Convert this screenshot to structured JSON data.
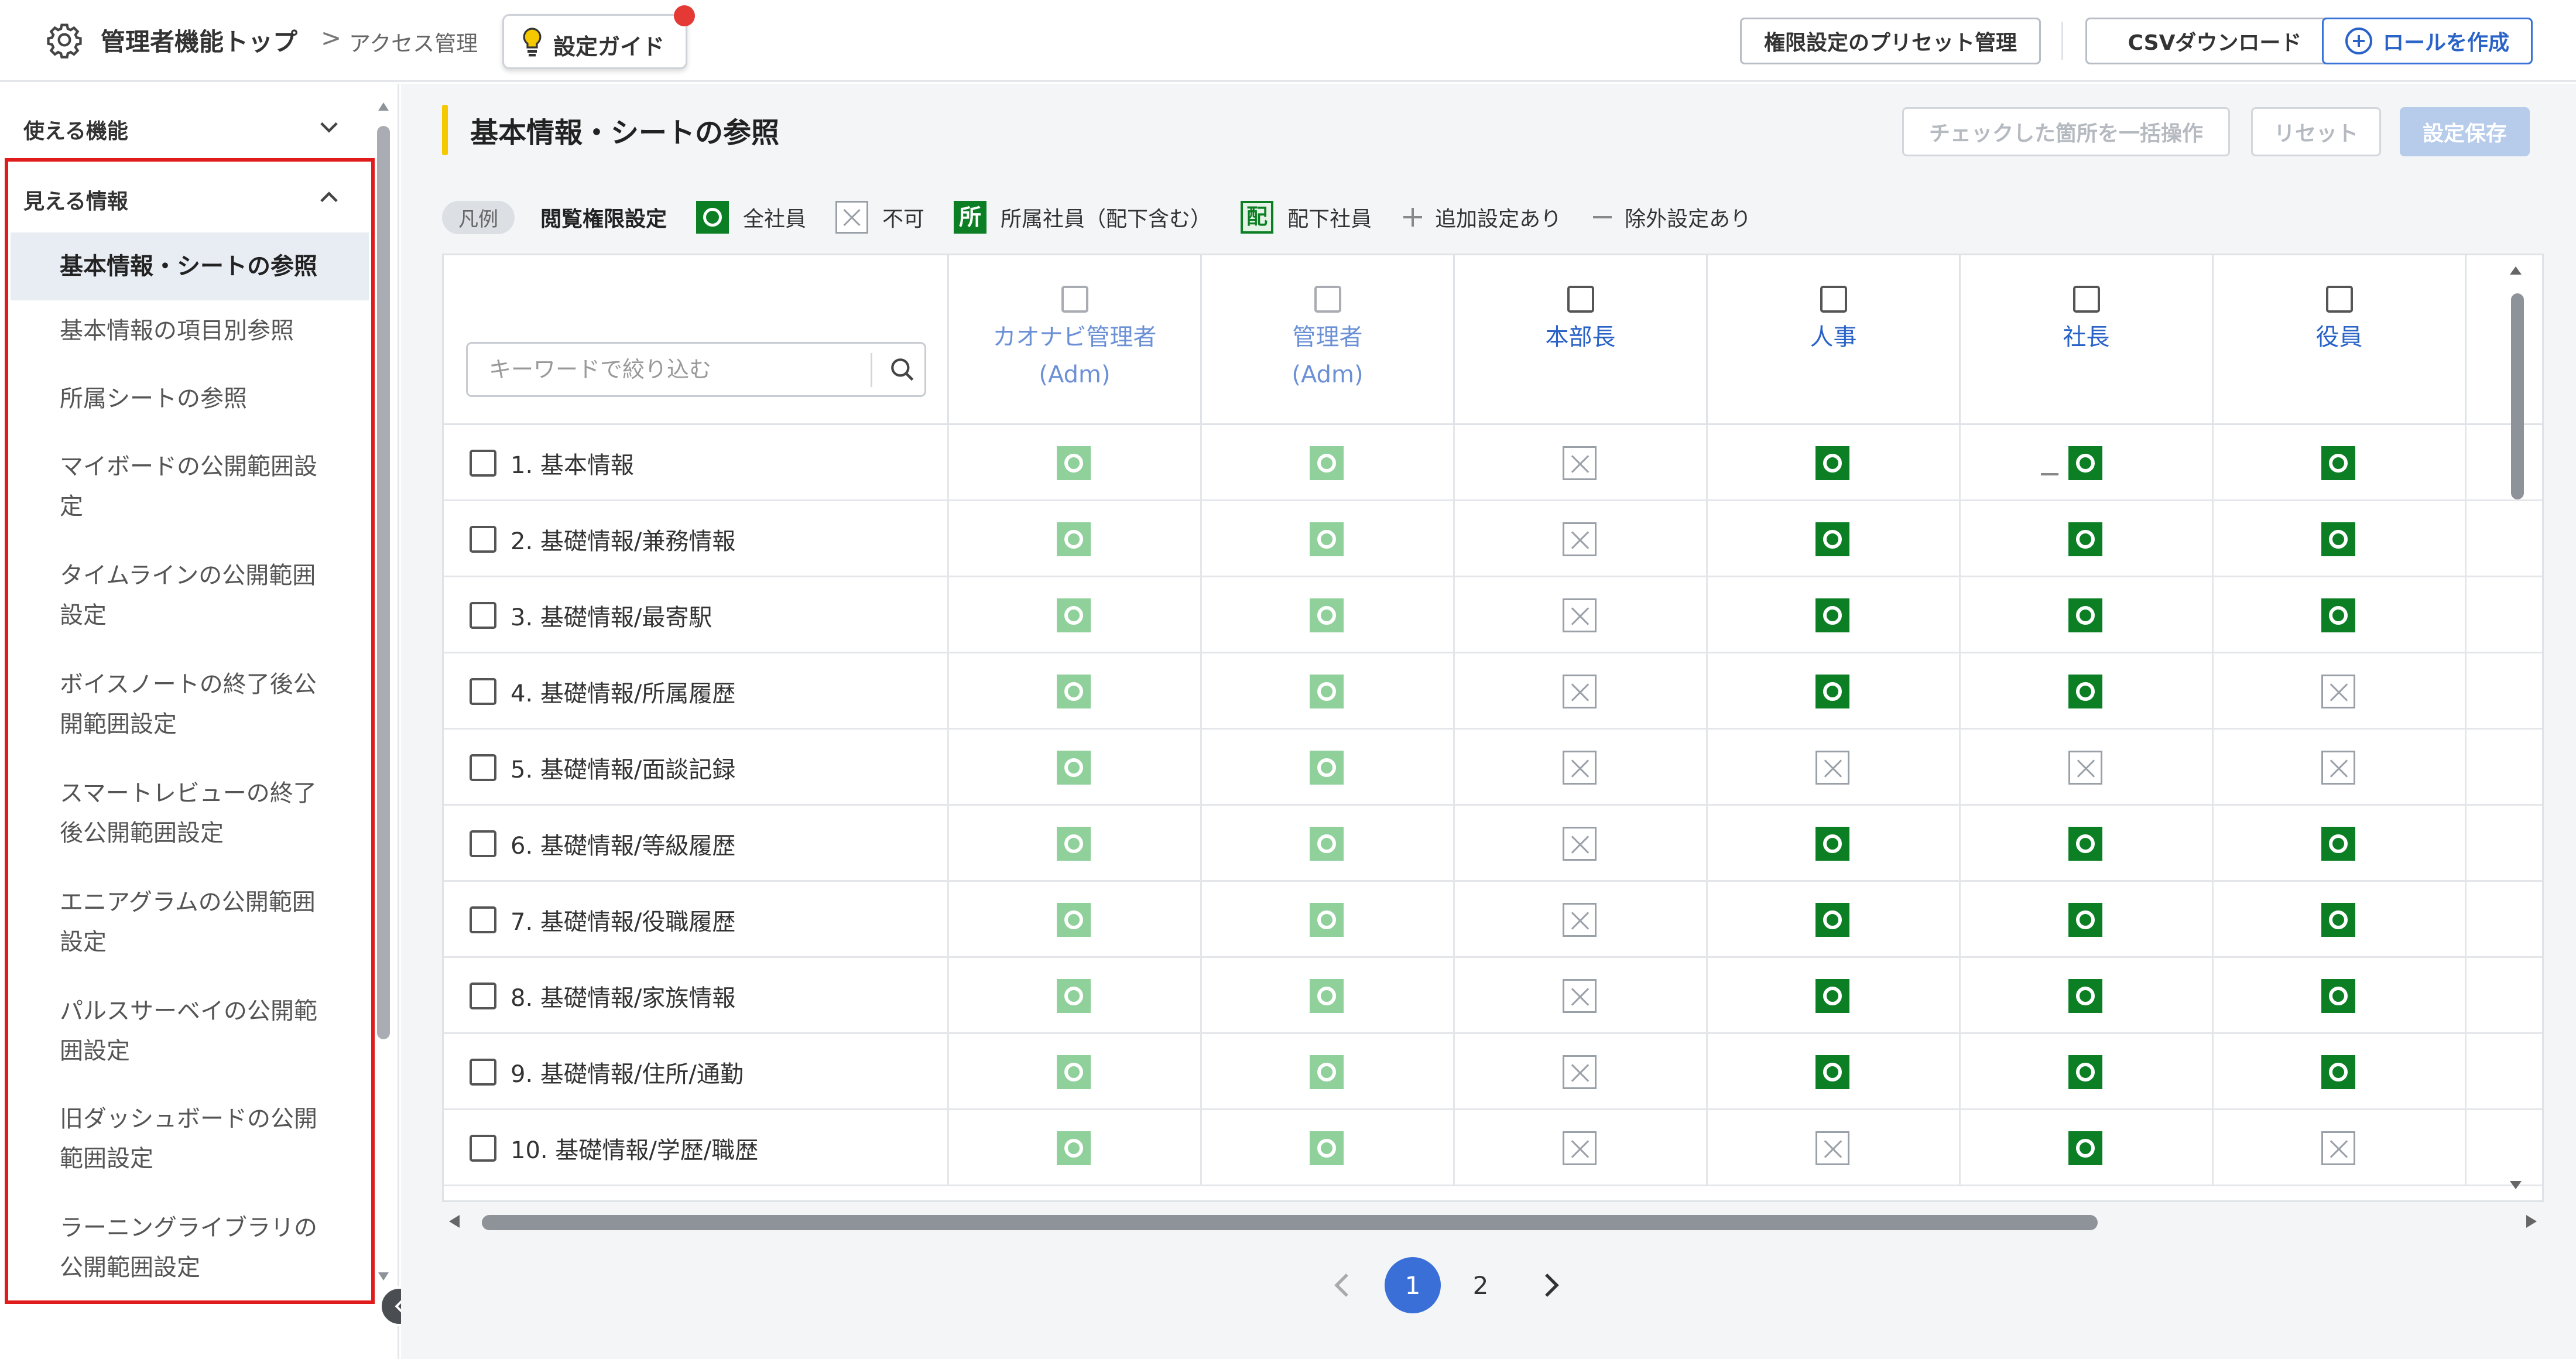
{
  "header": {
    "title": "管理者機能トップ",
    "breadcrumb_sep": ">",
    "breadcrumb": "アクセス管理",
    "guide_label": "設定ガイド",
    "preset_btn": "権限設定のプリセット管理",
    "csv_btn": "CSVダウンロード",
    "role_btn": "ロールを作成"
  },
  "sidebar": {
    "group1": "使える機能",
    "group2": "見える情報",
    "items": [
      "基本情報・シートの参照",
      "基本情報の項目別参照",
      "所属シートの参照",
      "マイボードの公開範囲設\n定",
      "タイムラインの公開範囲\n設定",
      "ボイスノートの終了後公\n開範囲設定",
      "スマートレビューの終了\n後公開範囲設定",
      "エニアグラムの公開範囲\n設定",
      "パルスサーベイの公開範\n囲設定",
      "旧ダッシュボードの公開\n範囲設定",
      "ラーニングライブラリの\n公開範囲設定"
    ]
  },
  "main": {
    "title": "基本情報・シートの参照",
    "bulk_btn": "チェックした箇所を一括操作",
    "reset_btn": "リセット",
    "save_btn": "設定保存",
    "legend": {
      "chip": "凡例",
      "title": "閲覧権限設定",
      "all": "全社員",
      "none": "不可",
      "affiliated_icon": "所",
      "affiliated": "所属社員（配下含む）",
      "subordinate_icon": "配",
      "subordinate": "配下社員",
      "add": "追加設定あり",
      "exclude": "除外設定あり"
    },
    "search_placeholder": "キーワードで絞り込む",
    "columns": [
      "カオナビ管理者\n(Adm)",
      "管理者\n(Adm)",
      "本部長",
      "人事",
      "社長",
      "役員"
    ],
    "rows": [
      {
        "label": "1. 基本情報",
        "marks": [
          "faded",
          "faded",
          "no",
          "all",
          "all",
          "all"
        ]
      },
      {
        "label": "2. 基礎情報/兼務情報",
        "marks": [
          "faded",
          "faded",
          "no",
          "all",
          "all",
          "all"
        ]
      },
      {
        "label": "3. 基礎情報/最寄駅",
        "marks": [
          "faded",
          "faded",
          "no",
          "all",
          "all",
          "all"
        ]
      },
      {
        "label": "4. 基礎情報/所属履歴",
        "marks": [
          "faded",
          "faded",
          "no",
          "all",
          "all",
          "no"
        ]
      },
      {
        "label": "5. 基礎情報/面談記録",
        "marks": [
          "faded",
          "faded",
          "no",
          "no",
          "no",
          "no"
        ]
      },
      {
        "label": "6. 基礎情報/等級履歴",
        "marks": [
          "faded",
          "faded",
          "no",
          "all",
          "all",
          "all"
        ]
      },
      {
        "label": "7. 基礎情報/役職履歴",
        "marks": [
          "faded",
          "faded",
          "no",
          "all",
          "all",
          "all"
        ]
      },
      {
        "label": "8. 基礎情報/家族情報",
        "marks": [
          "faded",
          "faded",
          "no",
          "all",
          "all",
          "all"
        ]
      },
      {
        "label": "9. 基礎情報/住所/通勤",
        "marks": [
          "faded",
          "faded",
          "no",
          "all",
          "all",
          "all"
        ]
      },
      {
        "label": "10. 基礎情報/学歴/職歴",
        "marks": [
          "faded",
          "faded",
          "no",
          "no",
          "all",
          "no"
        ]
      }
    ]
  },
  "pagination": {
    "pages": [
      "1",
      "2"
    ],
    "current": "1"
  },
  "colors": {
    "accent": "#3a6fd8",
    "green": "#0c7f24",
    "green_faded": "#8fd09b",
    "highlight": "#e01b1b",
    "section_bar": "#f5c800"
  }
}
